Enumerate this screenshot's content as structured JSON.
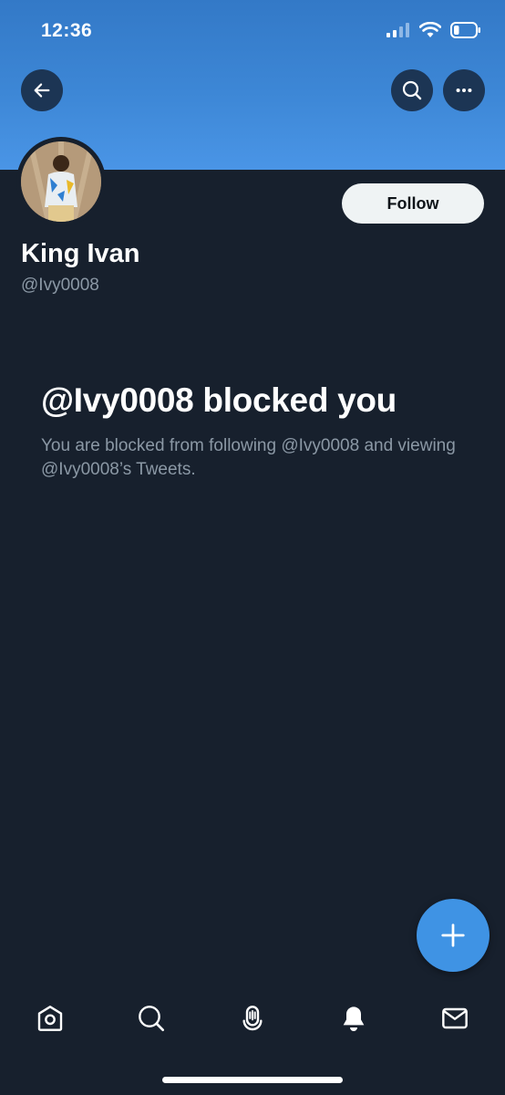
{
  "status_bar": {
    "time": "12:36",
    "battery_level": 0.25
  },
  "profile": {
    "display_name": "King Ivan",
    "handle": "@Ivy0008",
    "follow_label": "Follow"
  },
  "blocked": {
    "title": "@Ivy0008 blocked you",
    "description": "You are blocked from following @Ivy0008 and viewing @Ivy0008’s Tweets."
  },
  "icons": {
    "back": "arrow-left-icon",
    "search": "search-icon",
    "more": "more-horizontal-icon",
    "compose": "plus-icon",
    "tabs": [
      "home-icon",
      "search-icon",
      "spaces-icon",
      "notifications-icon",
      "messages-icon"
    ]
  },
  "colors": {
    "background": "#17202d",
    "banner": "#3d87d6",
    "accent": "#3f93e4",
    "secondary_text": "#8b98a5",
    "follow_button": "#eff3f4"
  }
}
